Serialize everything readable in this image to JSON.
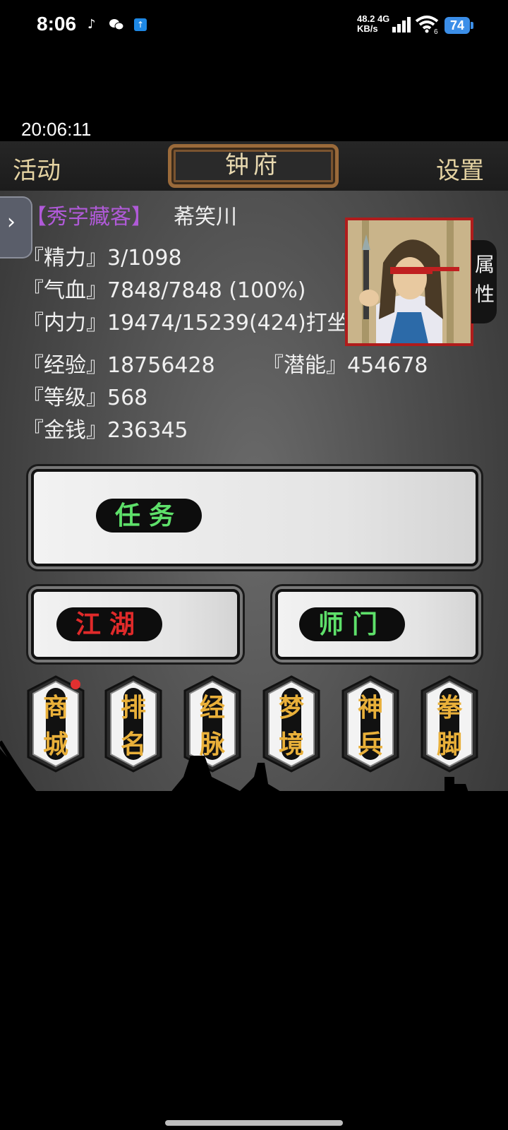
{
  "status_bar": {
    "time": "8:06",
    "net_speed_value": "48.2",
    "net_speed_unit": "KB/s",
    "network_type": "4G",
    "wifi_sub": "6",
    "battery": "74"
  },
  "game_clock": "20:06:11",
  "tabs": {
    "left": "活动",
    "center": "钟府",
    "right": "设置"
  },
  "player": {
    "rank": "【秀字藏客】",
    "name": "莃笑川",
    "attr_button": "属性"
  },
  "stats": {
    "jingli": "『精力』3/1098",
    "qixue": "『气血』7848/7848 (100%)",
    "neili": "『内力』19474/15239(424)打坐",
    "jingyan": "『经验』18756428",
    "qianneng": "『潜能』454678",
    "dengji": "『等级』568",
    "jinqian": "『金钱』236345"
  },
  "buttons": {
    "task": "任务",
    "jianghu": "江湖",
    "shimen": "师门"
  },
  "menu": [
    {
      "label_top": "商",
      "label_bottom": "城",
      "badge": true
    },
    {
      "label_top": "排",
      "label_bottom": "名",
      "badge": false
    },
    {
      "label_top": "经",
      "label_bottom": "脉",
      "badge": false
    },
    {
      "label_top": "梦",
      "label_bottom": "境",
      "badge": false
    },
    {
      "label_top": "神",
      "label_bottom": "兵",
      "badge": false
    },
    {
      "label_top": "拳",
      "label_bottom": "脚",
      "badge": false
    }
  ]
}
